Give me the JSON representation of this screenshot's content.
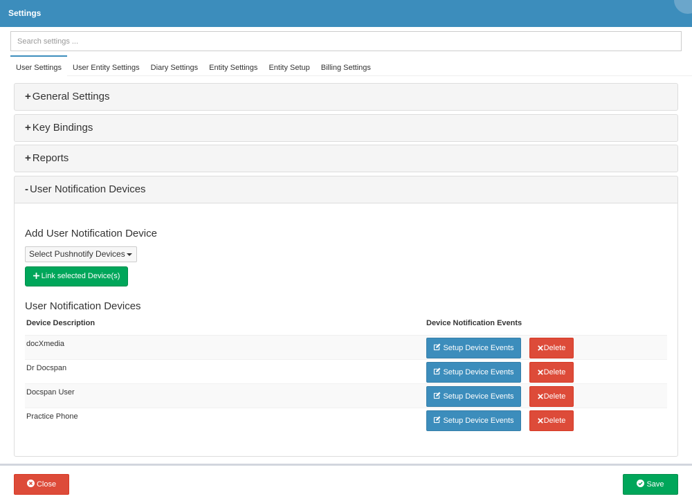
{
  "window": {
    "title": "Settings"
  },
  "search": {
    "placeholder": "Search settings ..."
  },
  "tabs": [
    {
      "label": "User Settings",
      "active": true
    },
    {
      "label": "User Entity Settings"
    },
    {
      "label": "Diary Settings"
    },
    {
      "label": "Entity Settings"
    },
    {
      "label": "Entity Setup"
    },
    {
      "label": "Billing Settings"
    }
  ],
  "panels": {
    "general": {
      "sign": "+",
      "label": "General Settings"
    },
    "key_bindings": {
      "sign": "+",
      "label": "Key Bindings"
    },
    "reports": {
      "sign": "+",
      "label": "Reports"
    },
    "notification_devices": {
      "sign": "-",
      "label": "User Notification Devices"
    }
  },
  "notification": {
    "add_title": "Add User Notification Device",
    "select_label": "Select Pushnotify Devices",
    "link_button": "Link selected Device(s)",
    "list_title": "User Notification Devices",
    "columns": {
      "description": "Device Description",
      "events": "Device Notification Events"
    },
    "devices": [
      {
        "description": "docXmedia",
        "setup_label": "Setup Device Events",
        "delete_label": "Delete"
      },
      {
        "description": "Dr Docspan",
        "setup_label": "Setup Device Events",
        "delete_label": "Delete"
      },
      {
        "description": "Docspan User",
        "setup_label": "Setup Device Events",
        "delete_label": "Delete"
      },
      {
        "description": "Practice Phone",
        "setup_label": "Setup Device Events",
        "delete_label": "Delete"
      }
    ]
  },
  "footer": {
    "close_label": "Close",
    "save_label": "Save"
  },
  "colors": {
    "header": "#3c8dbc",
    "primary": "#3c8dbc",
    "success": "#00a65a",
    "danger": "#dd4b39"
  },
  "icons": {
    "plus": "plus-icon",
    "edit": "edit-icon",
    "delete": "times-icon",
    "close": "times-circle-icon",
    "save": "check-circle-icon"
  }
}
